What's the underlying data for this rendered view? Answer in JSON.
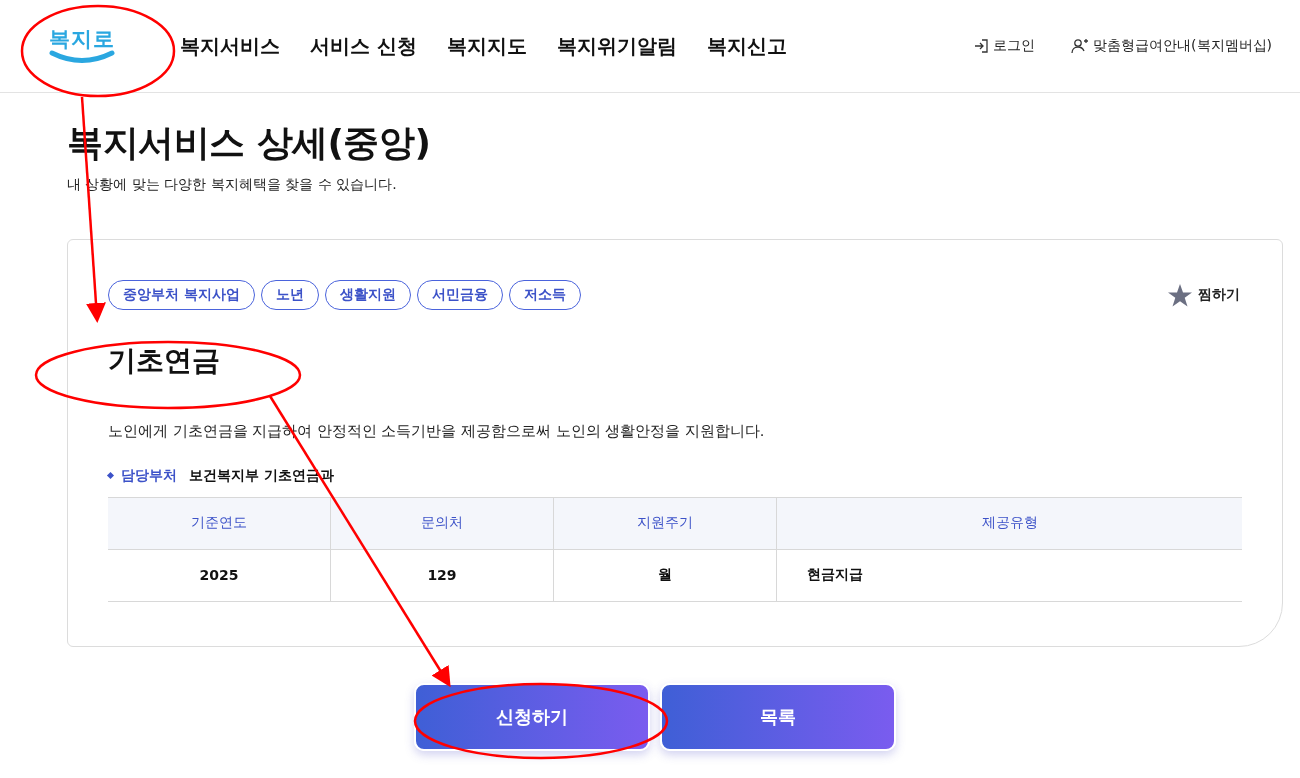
{
  "header": {
    "logo": "복지로",
    "nav": [
      "복지서비스",
      "서비스 신청",
      "복지지도",
      "복지위기알림",
      "복지신고"
    ],
    "utility": [
      {
        "kind": "login",
        "label": "로그인"
      },
      {
        "kind": "member",
        "label": "맞춤형급여안내(복지멤버십)"
      }
    ]
  },
  "page": {
    "title": "복지서비스 상세(중앙)",
    "subtitle": "내 상황에 맞는 다양한 복지혜택을 찾을 수 있습니다."
  },
  "service": {
    "tags": [
      "중앙부처 복지사업",
      "노년",
      "생활지원",
      "서민금융",
      "저소득"
    ],
    "favorite": "찜하기",
    "name": "기초연금",
    "description": "노인에게 기초연금을 지급하여 안정적인 소득기반을 제공함으로써 노인의 생활안정을 지원합니다.",
    "department": {
      "label": "담당부처",
      "value": "보건복지부 기초연금과"
    },
    "table": {
      "columns": [
        "기준연도",
        "문의처",
        "지원주기",
        "제공유형"
      ],
      "rows": [
        [
          "2025",
          "129",
          "월",
          "현금지급"
        ]
      ]
    }
  },
  "buttons": [
    "신청하기",
    "목록"
  ]
}
